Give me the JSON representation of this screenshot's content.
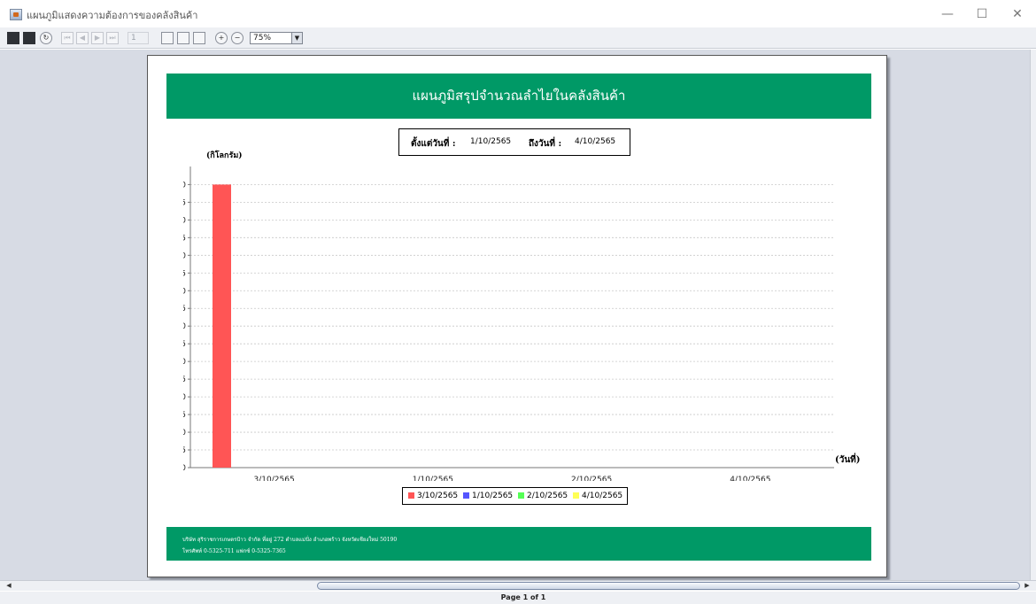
{
  "window": {
    "title": "แผนภูมิแสดงความต้องการของคลังสินค้า",
    "minimize_symbol": "—",
    "maximize_symbol": "☐",
    "close_symbol": "✕"
  },
  "toolbar": {
    "page_number": "1",
    "zoom_value": "75%",
    "icons": [
      "save-icon",
      "print-icon",
      "refresh-icon",
      "first-page-icon",
      "prev-page-icon",
      "next-page-icon",
      "last-page-icon",
      "actual-size-icon",
      "fit-page-icon",
      "fit-width-icon",
      "zoom-in-icon",
      "zoom-out-icon"
    ]
  },
  "report": {
    "title": "แผนภูมิสรุปจำนวณลำไยในคลังสินค้า",
    "from_label": "ตั้งแต่วันที่ :",
    "from_date": "1/10/2565",
    "to_label": "ถึงวันที่ :",
    "to_date": "4/10/2565",
    "footer_line1": "บริษัท สุริราชการเกษตรป้าว จำกัด  ที่อยู่ 272 ตำบลแม่ปั่ง อำเภอพร้าว จังหวัดเชียงใหม่ 50190",
    "footer_line2": "โทรศัพท์ 0-5325-711 แฟกซ์ 0-5325-7365",
    "colors": {
      "band": "#009966"
    }
  },
  "chart_data": {
    "type": "bar",
    "ylabel": "(กิโลกรัม)",
    "xlabel": "(วันที่)",
    "ylim": [
      0,
      8.0
    ],
    "ytick_step": 0.5,
    "grid": true,
    "legend_position": "bottom",
    "categories": [
      "3/10/2565",
      "1/10/2565",
      "2/10/2565",
      "4/10/2565"
    ],
    "series": [
      {
        "name": "3/10/2565",
        "color": "#ff5555",
        "values": [
          8.0,
          0,
          0,
          0
        ]
      },
      {
        "name": "1/10/2565",
        "color": "#5555ff",
        "values": [
          0,
          0,
          0,
          0
        ]
      },
      {
        "name": "2/10/2565",
        "color": "#55ff55",
        "values": [
          0,
          0,
          0,
          0
        ]
      },
      {
        "name": "4/10/2565",
        "color": "#ffff55",
        "values": [
          0,
          0,
          0,
          0
        ]
      }
    ]
  },
  "status": {
    "page_info": "Page 1 of 1"
  }
}
